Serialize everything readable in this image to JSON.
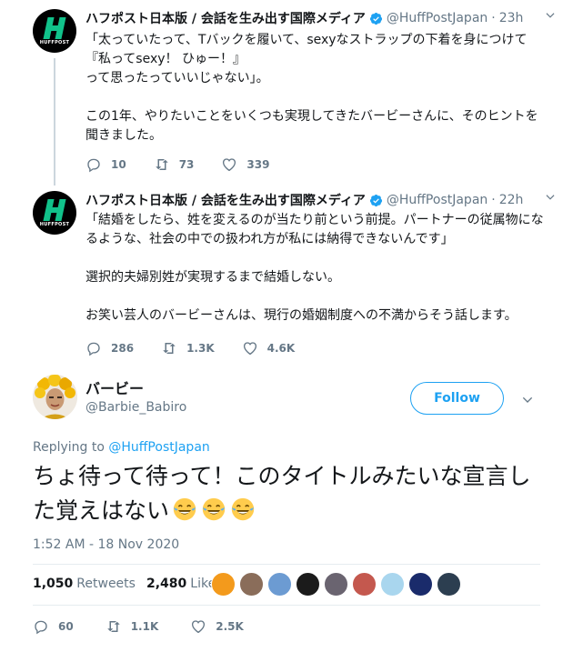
{
  "tweets": [
    {
      "author_name": "ハフポスト日本版 / 会話を生み出す国際メディア",
      "author_handle": "@HuffPostJapan",
      "time": "23h",
      "text": "「太っていたって、Tバックを履いて、sexyなストラップの下着を身につけて『私ってsexy！ ひゅー！』\nって思ったっていいじゃない」。\n\nこの1年、やりたいことをいくつも実現してきたバービーさんに、そのヒントを聞きました。",
      "replies": "10",
      "retweets": "73",
      "likes": "339"
    },
    {
      "author_name": "ハフポスト日本版 / 会話を生み出す国際メディア",
      "author_handle": "@HuffPostJapan",
      "time": "22h",
      "text": "「結婚をしたら、姓を変えるのが当たり前という前提。パートナーの従属物になるような、社会の中での扱われ方が私には納得できないんです」\n\n選択的夫婦別姓が実現するまで結婚しない。\n\nお笑い芸人のバービーさんは、現行の婚姻制度への不満からそう話します。",
      "replies": "286",
      "retweets": "1.3K",
      "likes": "4.6K"
    }
  ],
  "huffpost_logo_text": "HUFFPOST",
  "main_tweet": {
    "author_name": "バービー",
    "author_handle": "@Barbie_Babiro",
    "follow_label": "Follow",
    "replying_prefix": "Replying to",
    "replying_to": "@HuffPostJapan",
    "text": "ちょ待って待って！このタイトルみたいな宣言した覚えはない",
    "emoji": [
      "face-with-tears-of-joy",
      "face-with-tears-of-joy",
      "face-with-tears-of-joy"
    ],
    "timestamp": "1:52 AM - 18 Nov 2020",
    "retweets_count": "1,050",
    "retweets_label": "Retweets",
    "likes_count": "2,480",
    "likes_label": "Likes",
    "replies": "60",
    "retweets": "1.1K",
    "likes": "2.5K"
  },
  "colors": {
    "accent": "#1da1f2",
    "huffpost_green": "#11c28a",
    "muted": "#657786"
  }
}
